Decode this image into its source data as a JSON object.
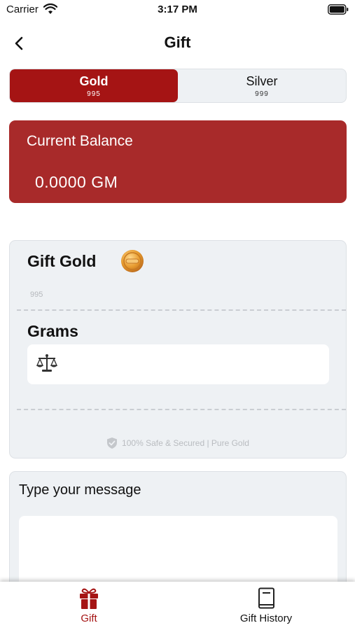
{
  "status_bar": {
    "carrier": "Carrier",
    "time": "3:17 PM"
  },
  "header": {
    "title": "Gift"
  },
  "metal_selector": {
    "tabs": [
      {
        "name": "Gold",
        "purity": "995",
        "selected": true
      },
      {
        "name": "Silver",
        "purity": "999",
        "selected": false
      }
    ]
  },
  "balance": {
    "label": "Current Balance",
    "value": "0.0000 GM"
  },
  "gift_form": {
    "title": "Gift Gold",
    "purity": "995",
    "grams_label": "Grams",
    "grams_value": "",
    "secure_note": "100% Safe & Secured | Pure Gold"
  },
  "message": {
    "label": "Type your message",
    "value": ""
  },
  "tab_bar": {
    "items": [
      {
        "label": "Gift",
        "icon": "gift-icon",
        "active": true
      },
      {
        "label": "Gift History",
        "icon": "book-icon",
        "active": false
      }
    ]
  },
  "colors": {
    "accent": "#a51414",
    "balance_card": "#a82a2a",
    "card_bg": "#eef1f4",
    "muted_text": "#b9bcc0"
  }
}
